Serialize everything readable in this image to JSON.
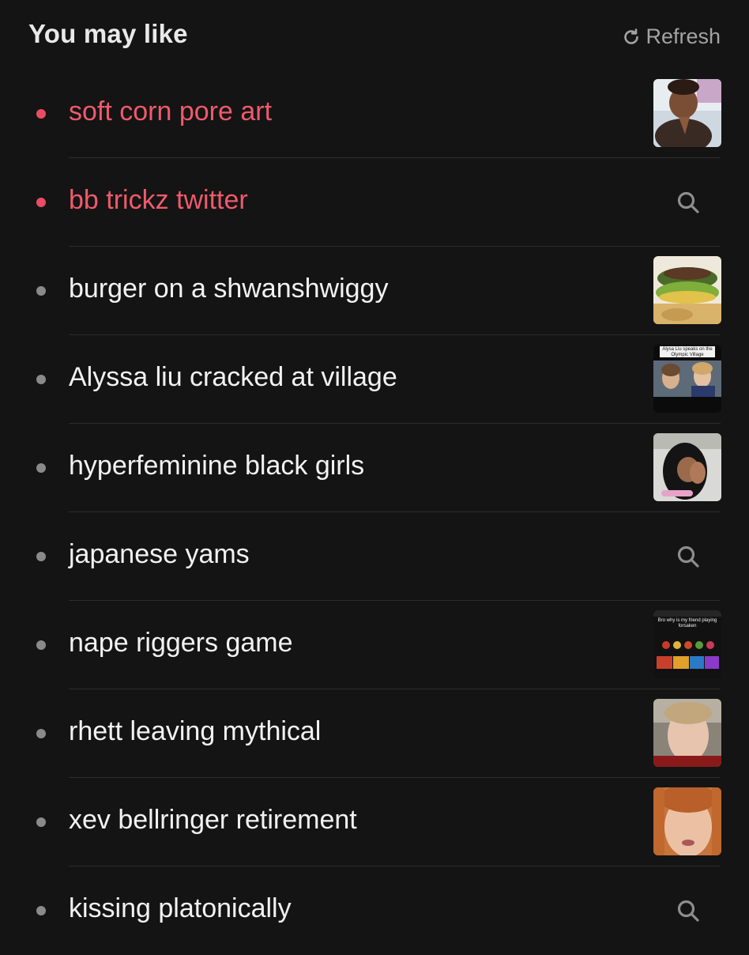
{
  "header": {
    "title": "You may like",
    "refresh_label": "Refresh"
  },
  "colors": {
    "accent": "#ef5a6b",
    "background": "#141414",
    "muted": "#a3a3a3"
  },
  "suggestions": [
    {
      "label": "soft corn pore art",
      "highlighted": true,
      "trailing": "thumbnail"
    },
    {
      "label": "bb trickz twitter",
      "highlighted": true,
      "trailing": "search-icon"
    },
    {
      "label": "burger on a shwanshwiggy",
      "highlighted": false,
      "trailing": "thumbnail"
    },
    {
      "label": "Alyssa liu cracked at village",
      "highlighted": false,
      "trailing": "thumbnail",
      "thumb_caption": "Alysa Liu speaks on the Olympic Village"
    },
    {
      "label": "hyperfeminine black girls",
      "highlighted": false,
      "trailing": "thumbnail"
    },
    {
      "label": "japanese yams",
      "highlighted": false,
      "trailing": "search-icon"
    },
    {
      "label": "nape riggers game",
      "highlighted": false,
      "trailing": "thumbnail",
      "thumb_caption": "Bro why is my friend playing forsaken"
    },
    {
      "label": "rhett leaving mythical",
      "highlighted": false,
      "trailing": "thumbnail"
    },
    {
      "label": "xev bellringer retirement",
      "highlighted": false,
      "trailing": "thumbnail"
    },
    {
      "label": "kissing platonically",
      "highlighted": false,
      "trailing": "search-icon"
    }
  ]
}
